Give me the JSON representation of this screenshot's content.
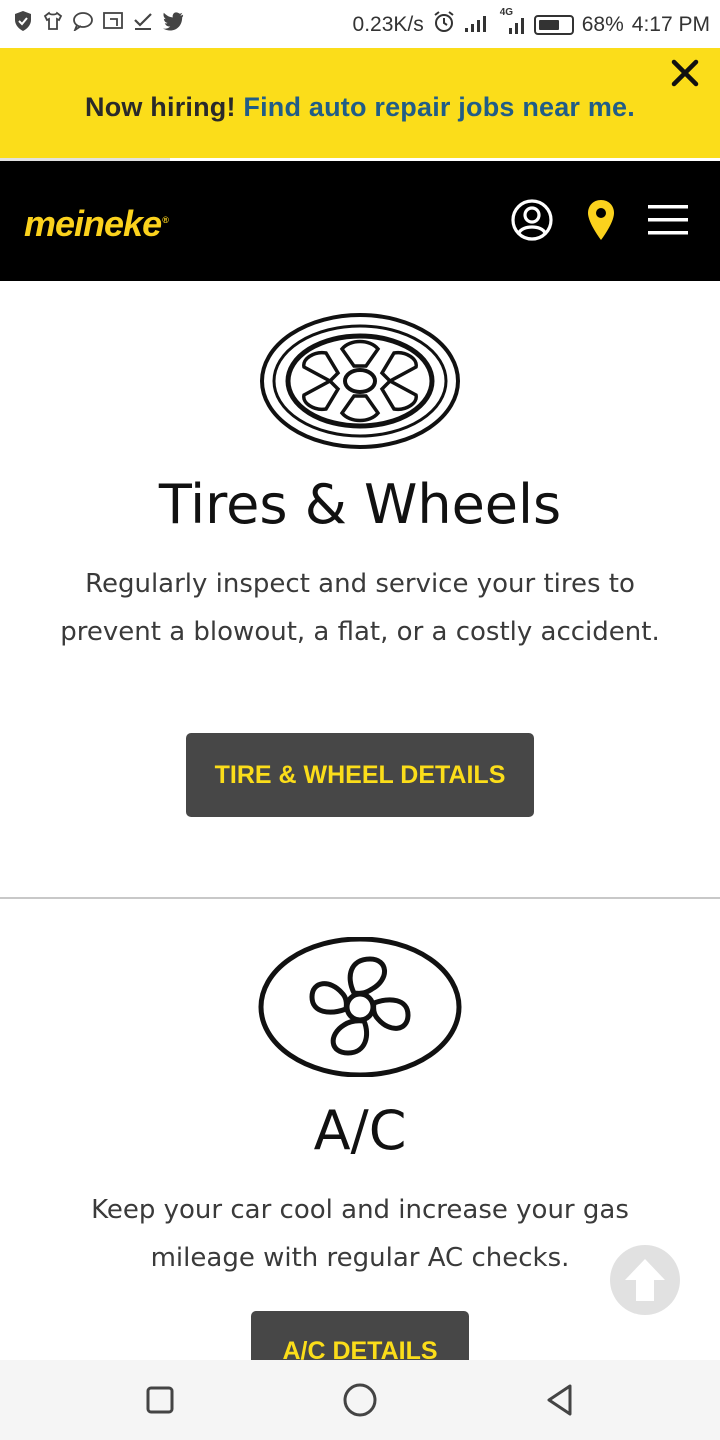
{
  "status_bar": {
    "left_icons": [
      "shield-icon",
      "shirt-icon",
      "chat-icon",
      "cast-icon",
      "download-check-icon",
      "twitter-icon"
    ],
    "network_speed": "0.23K/s",
    "network_type": "4G",
    "battery": "68%",
    "battery_level": 0.68,
    "time": "4:17 PM"
  },
  "banner": {
    "lead": "Now hiring!",
    "link": "Find auto repair jobs near me.",
    "background": "#fbdd1a",
    "link_color": "#215d87"
  },
  "header": {
    "logo": "meineke",
    "logo_mark": "®",
    "icons": [
      "account-icon",
      "location-pin-icon",
      "menu-icon"
    ],
    "accent": "#fbd21d"
  },
  "services": [
    {
      "icon": "tire-icon",
      "title": "Tires & Wheels",
      "description": "Regularly inspect and service your tires to prevent a blowout, a flat, or a costly accident.",
      "button": "TIRE & WHEEL DETAILS"
    },
    {
      "icon": "ac-fan-icon",
      "title": "A/C",
      "description": "Keep your car cool and increase your gas mileage with regular AC checks.",
      "button": "A/C DETAILS"
    }
  ],
  "back_to_top": "arrow-up-icon",
  "nav_bar": [
    "recents-square-icon",
    "home-circle-icon",
    "back-triangle-icon"
  ]
}
